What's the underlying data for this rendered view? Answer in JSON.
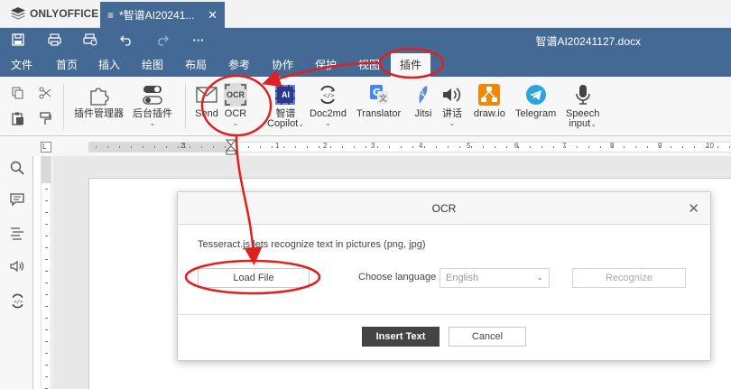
{
  "app": {
    "brand": "ONLYOFFICE",
    "tab_title": "*智谱AI20241...",
    "tab_close": "✕"
  },
  "header": {
    "doc_title": "智谱AI20241127.docx",
    "more": "···"
  },
  "menu": {
    "items": [
      "文件",
      "首页",
      "插入",
      "绘图",
      "布局",
      "参考",
      "协作",
      "保护",
      "视图",
      "插件"
    ],
    "active": "插件"
  },
  "toolbar": {
    "plugin_manager": "插件管理器",
    "background_plugins": "后台插件",
    "send": "Send",
    "ocr": "OCR",
    "ocr_icon_text": "OCR",
    "zhipu": "智谱",
    "copilot": "Copilot",
    "ai_badge": "AI",
    "doc2md": "Doc2md",
    "translator": "Translator",
    "jitsi": "Jitsi",
    "speech": "讲话",
    "drawio": "draw.io",
    "telegram": "Telegram",
    "speech_input_1": "Speech",
    "speech_input_2": "input",
    "caret": "⌄"
  },
  "ruler": {
    "corner": "L",
    "numbers": [
      "2",
      "1",
      "1",
      "2",
      "3",
      "4",
      "5",
      "6",
      "7",
      "8",
      "9",
      "10"
    ]
  },
  "dialog": {
    "title": "OCR",
    "description": "Tesseract.js lets recognize text in pictures (png, jpg)",
    "load_file": "Load File",
    "choose_language": "Choose language",
    "language_value": "English",
    "recognize": "Recognize",
    "insert_text": "Insert Text",
    "cancel": "Cancel"
  },
  "colors": {
    "brand": "#446995",
    "annotation": "#e02020",
    "toolbar_bg": "#f7f7f7"
  },
  "icons": [
    "save-icon",
    "print-icon",
    "quick-print-icon",
    "undo-icon",
    "redo-icon",
    "copy-icon",
    "cut-icon",
    "paste-icon",
    "format-painter-icon",
    "search-icon",
    "comment-icon",
    "headings-icon",
    "speech-icon",
    "doc2md-icon",
    "close-icon"
  ]
}
